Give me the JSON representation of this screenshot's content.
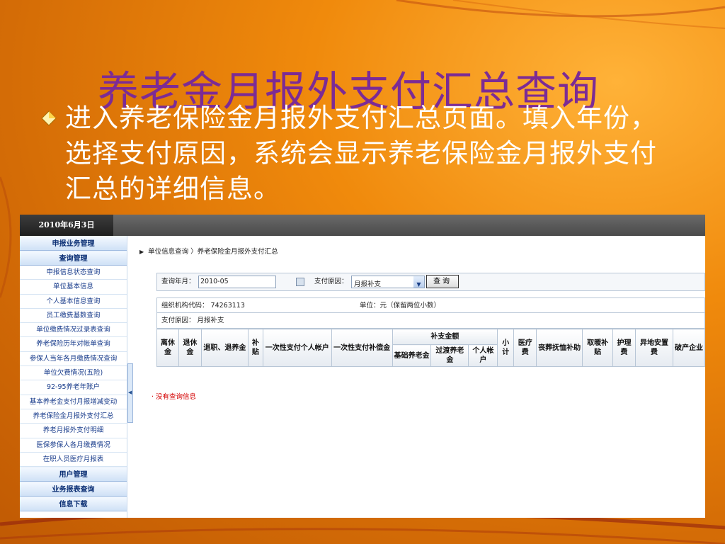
{
  "slide": {
    "title": "养老金月报外支付汇总查询",
    "bullet": "进入养老保险金月报外支付汇总页面。填入年份，选择支付原因，系统会显示养老保险金月报外支付汇总的详细信息。"
  },
  "app": {
    "date": "2010年6月3日",
    "sidebar": {
      "sections": [
        {
          "title": "申报业务管理",
          "items": []
        },
        {
          "title": "查询管理",
          "items": [
            "申报信息状态查询",
            "单位基本信息",
            "个人基本信息查询",
            "员工缴费基数查询",
            "单位缴费情况过录表查询",
            "养老保险历年对帐单查询",
            "参保人当年各月缴费情况查询",
            "单位欠费情况(五险)",
            "92-95养老年账户",
            "基本养老金支付月报增减变动",
            "养老保险金月报外支付汇总",
            "养老月报外支付明细",
            "医保参保人各月缴费情况",
            "在职人员医疗月报表"
          ]
        },
        {
          "title": "用户管理",
          "items": []
        },
        {
          "title": "业务报表查询",
          "items": []
        },
        {
          "title": "信息下载",
          "items": []
        }
      ]
    },
    "breadcrumb": "单位信息查询 〉养老保险金月报外支付汇总",
    "query": {
      "year_label": "查询年月：",
      "year_value": "2010-05",
      "reason_label": "支付原因：",
      "reason_value": "月报补支",
      "button": "查询"
    },
    "info": {
      "org_code": "组织机构代码： 74263113",
      "unit": "单位：元（保留两位小数）",
      "reason": "支付原因： 月报补支"
    },
    "table": {
      "headers": {
        "c1": "离休金",
        "c2": "退休金",
        "c3": "退职、退养金",
        "c4": "补贴",
        "c5": "一次性支付个人帐户",
        "c6": "一次性支付补偿金",
        "group": "补支金额",
        "g1": "基础养老金",
        "g2": "过渡养老金",
        "g3": "个人帐户",
        "c7": "小计",
        "c8": "医疗费",
        "c9": "丧葬抚恤补助",
        "c10": "取暖补贴",
        "c11": "护理费",
        "c12": "异地安置费",
        "c13": "破产企业"
      }
    },
    "no_result": "· 没有查询信息"
  },
  "colors": {
    "background": "#e07a08",
    "title": "#7c2b95",
    "bullet_text": "#ffffff",
    "sidebar_text": "#1a3d8c",
    "no_result": "#d40000"
  }
}
